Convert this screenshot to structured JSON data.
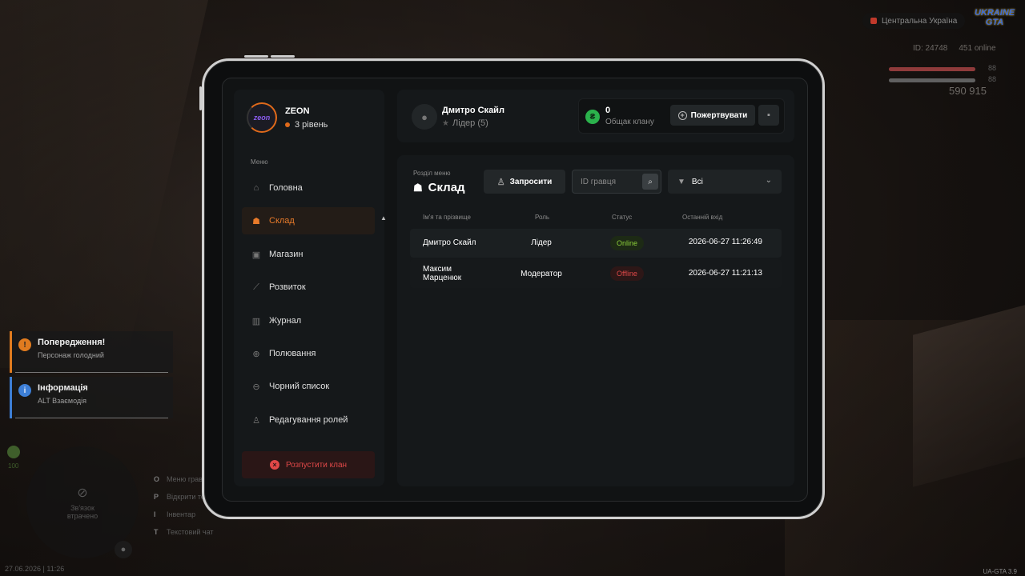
{
  "hud": {
    "region": "Центральна Україна",
    "logo": "UKRAINE GTA",
    "player_id": "ID: 24748",
    "online": "451 online",
    "health": "88",
    "armor": "88",
    "money": "590 915"
  },
  "notifications": [
    {
      "title": "Попередження!",
      "text": "Персонаж голодний"
    },
    {
      "title": "Інформація",
      "text": "ALT Взаємодія"
    }
  ],
  "minimap": {
    "status_value": "100",
    "lost": "Зв'язок втрачено"
  },
  "hints": [
    {
      "key": "O",
      "label": "Меню гравця"
    },
    {
      "key": "P",
      "label": "Відкрити телефон"
    },
    {
      "key": "I",
      "label": "Інвентар"
    },
    {
      "key": "T",
      "label": "Текстовий чат"
    }
  ],
  "datetime": "27.06.2026 | 11:26",
  "version": "UA-GTA 3.9",
  "clan": {
    "name": "ZEON",
    "level": "3 рівень",
    "avatar_text": "zeon"
  },
  "menu": {
    "caption": "Меню",
    "items": [
      {
        "label": "Головна",
        "icon": "home-icon"
      },
      {
        "label": "Склад",
        "icon": "members-icon"
      },
      {
        "label": "Магазин",
        "icon": "shop-icon"
      },
      {
        "label": "Розвиток",
        "icon": "chart-icon"
      },
      {
        "label": "Журнал",
        "icon": "book-icon"
      },
      {
        "label": "Полювання",
        "icon": "crosshair-icon"
      },
      {
        "label": "Чорний список",
        "icon": "block-icon"
      },
      {
        "label": "Редагування ролей",
        "icon": "user-edit-icon"
      }
    ],
    "active": "Склад",
    "disband_label": "Розпустити клан"
  },
  "user": {
    "name": "Дмитро Скайл",
    "role": "Лідер (5)"
  },
  "bank": {
    "amount": "0",
    "label": "Общак клану",
    "donate_label": "Пожертвувати"
  },
  "section": {
    "caption": "Розділ меню",
    "title": "Склад",
    "invite_label": "Запросити",
    "search_placeholder": "ID гравця",
    "filter_value": "Всі"
  },
  "table": {
    "headers": [
      "Ім'я та прізвище",
      "Роль",
      "Статус",
      "Останній вхід"
    ],
    "rows": [
      {
        "name": "Дмитро Скайл",
        "role": "Лідер",
        "status": "Online",
        "last_login": "2026-06-27 11:26:49"
      },
      {
        "name_line1": "Максим",
        "name_line2": "Марценюк",
        "role": "Модератор",
        "status": "Offline",
        "last_login": "2026-06-27 11:21:13"
      }
    ]
  },
  "colors": {
    "accent": "#e87a2a",
    "online": "#8ccf3a",
    "offline": "#e04848",
    "bank_coin": "#2bb24c"
  }
}
